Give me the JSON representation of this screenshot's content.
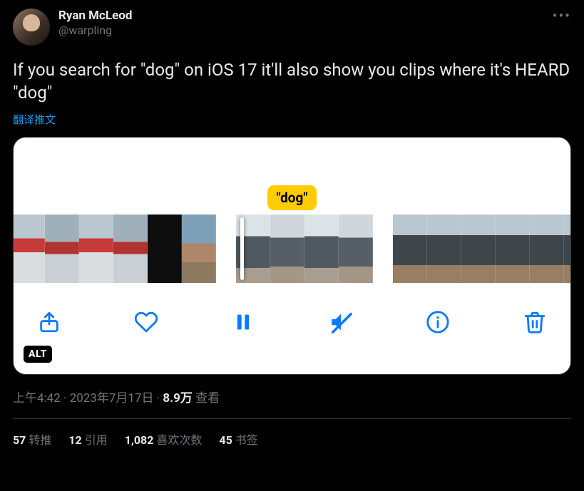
{
  "author": {
    "display_name": "Ryan McLeod",
    "handle": "@warpling"
  },
  "tweet_text": "If you search for \"dog\" on iOS 17 it'll also show you clips where it's HEARD \"dog\"",
  "translate_label": "翻译推文",
  "media": {
    "caption_chip": "\"dog\"",
    "alt_badge": "ALT"
  },
  "meta": {
    "time": "上午4:42",
    "date": "2023年7月17日",
    "views_count": "8.9万",
    "views_label": "查看",
    "separator": " · "
  },
  "stats": {
    "retweets_count": "57",
    "retweets_label": "转推",
    "quotes_count": "12",
    "quotes_label": "引用",
    "likes_count": "1,082",
    "likes_label": "喜欢次数",
    "bookmarks_count": "45",
    "bookmarks_label": "书签"
  }
}
